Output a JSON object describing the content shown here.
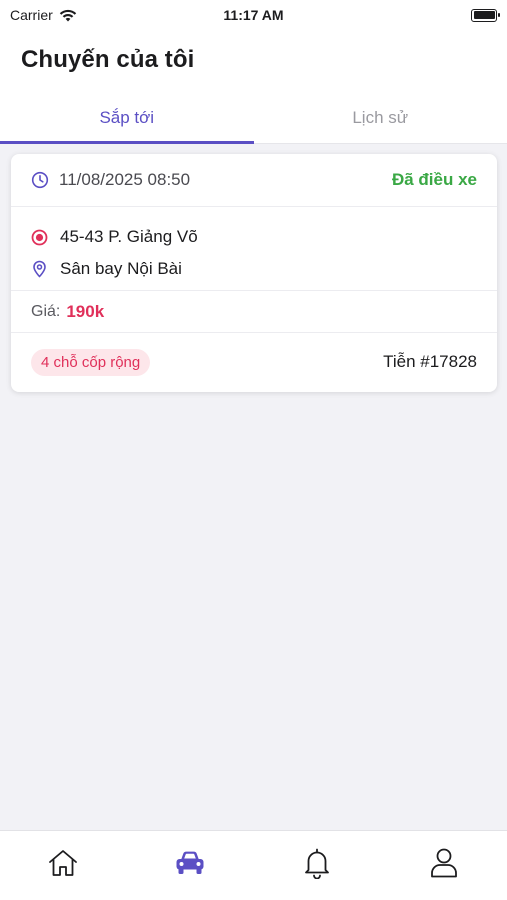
{
  "status_bar": {
    "carrier": "Carrier",
    "time": "11:17 AM"
  },
  "header": {
    "title": "Chuyến của tôi"
  },
  "tabs": [
    {
      "label": "Sắp tới",
      "active": true
    },
    {
      "label": "Lịch sử",
      "active": false
    }
  ],
  "trip": {
    "datetime": "11/08/2025 08:50",
    "status": "Đã điều xe",
    "pickup": "45-43 P. Giảng Võ",
    "dropoff": "Sân bay Nội Bài",
    "price_label": "Giá:",
    "price_value": "190k",
    "vehicle_badge": "4 chỗ cốp rộng",
    "trip_id": "Tiễn #17828"
  },
  "bottom_nav": [
    {
      "icon": "home-icon",
      "active": false
    },
    {
      "icon": "car-icon",
      "active": true
    },
    {
      "icon": "bell-icon",
      "active": false
    },
    {
      "icon": "user-icon",
      "active": false
    }
  ],
  "colors": {
    "accent": "#5b4fc4",
    "status_green": "#3aa845",
    "price_red": "#e0305a",
    "badge_bg": "#fde6ea",
    "background": "#f2f2f6"
  }
}
